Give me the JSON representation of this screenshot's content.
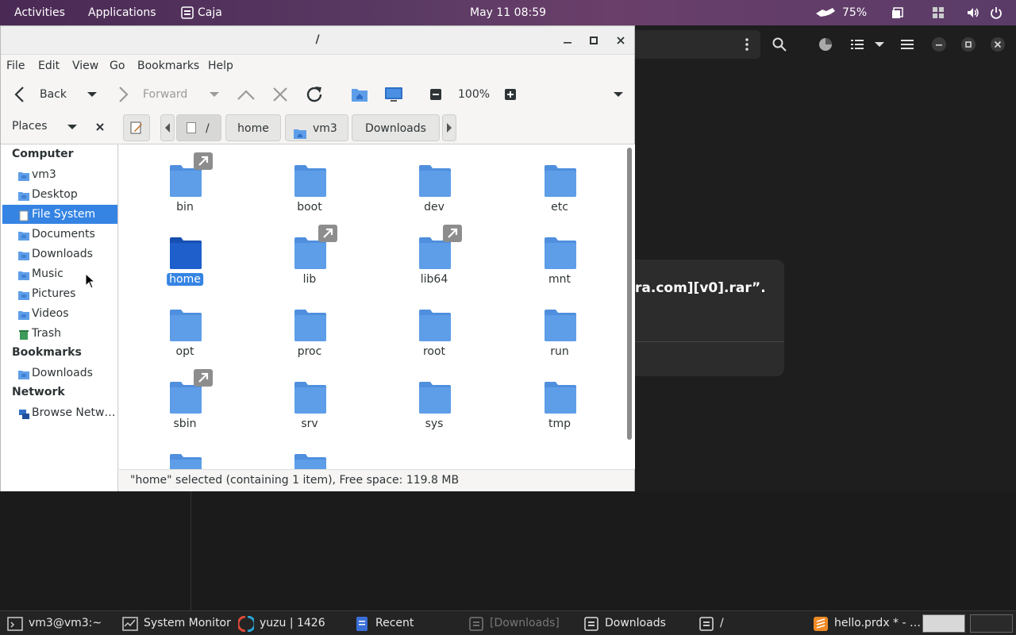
{
  "topbar": {
    "activities": "Activities",
    "applications": "Applications",
    "app_name": "Caja",
    "clock": "May 11  08:59",
    "battery": "75%"
  },
  "background": {
    "dialog_text": "ra.com][v0].rar”."
  },
  "window": {
    "title": "/"
  },
  "menu": [
    "File",
    "Edit",
    "View",
    "Go",
    "Bookmarks",
    "Help"
  ],
  "toolbar": {
    "back": "Back",
    "forward": "Forward",
    "zoom": "100%"
  },
  "location": {
    "places_label": "Places",
    "crumbs": [
      "/",
      "home",
      "vm3",
      "Downloads"
    ]
  },
  "sidebar": {
    "computer_head": "Computer",
    "computer_items": [
      "vm3",
      "Desktop",
      "File System",
      "Documents",
      "Downloads",
      "Music",
      "Pictures",
      "Videos",
      "Trash"
    ],
    "bookmarks_head": "Bookmarks",
    "bookmark_items": [
      "Downloads"
    ],
    "network_head": "Network",
    "network_items": [
      "Browse Netw…"
    ]
  },
  "files": [
    {
      "name": "bin",
      "link": true
    },
    {
      "name": "boot",
      "link": false
    },
    {
      "name": "dev",
      "link": false
    },
    {
      "name": "etc",
      "link": false
    },
    {
      "name": "home",
      "link": false,
      "selected": true
    },
    {
      "name": "lib",
      "link": true
    },
    {
      "name": "lib64",
      "link": true
    },
    {
      "name": "mnt",
      "link": false
    },
    {
      "name": "opt",
      "link": false
    },
    {
      "name": "proc",
      "link": false
    },
    {
      "name": "root",
      "link": false
    },
    {
      "name": "run",
      "link": false
    },
    {
      "name": "sbin",
      "link": true
    },
    {
      "name": "srv",
      "link": false
    },
    {
      "name": "sys",
      "link": false
    },
    {
      "name": "tmp",
      "link": false
    },
    {
      "name": "",
      "link": false
    },
    {
      "name": "",
      "link": false
    }
  ],
  "status": "\"home\" selected (containing 1 item), Free space: 119.8 MB",
  "taskbar": [
    {
      "label": "vm3@vm3:~",
      "icon": "terminal-icon"
    },
    {
      "label": "System Monitor",
      "icon": "system-monitor-icon"
    },
    {
      "label": "yuzu | 1426",
      "icon": "yuzu-icon"
    },
    {
      "label": "Recent",
      "icon": "recent-icon"
    },
    {
      "label": "[Downloads]",
      "icon": "folder-window-icon"
    },
    {
      "label": "Downloads",
      "icon": "folder-window-icon"
    },
    {
      "label": "/",
      "icon": "folder-window-icon"
    },
    {
      "label": "hello.prdx * - …",
      "icon": "sublime-icon"
    }
  ],
  "colors": {
    "accent": "#3584e4",
    "folder": "#5e9ee8",
    "folder_selected": "#1f5fcc"
  }
}
